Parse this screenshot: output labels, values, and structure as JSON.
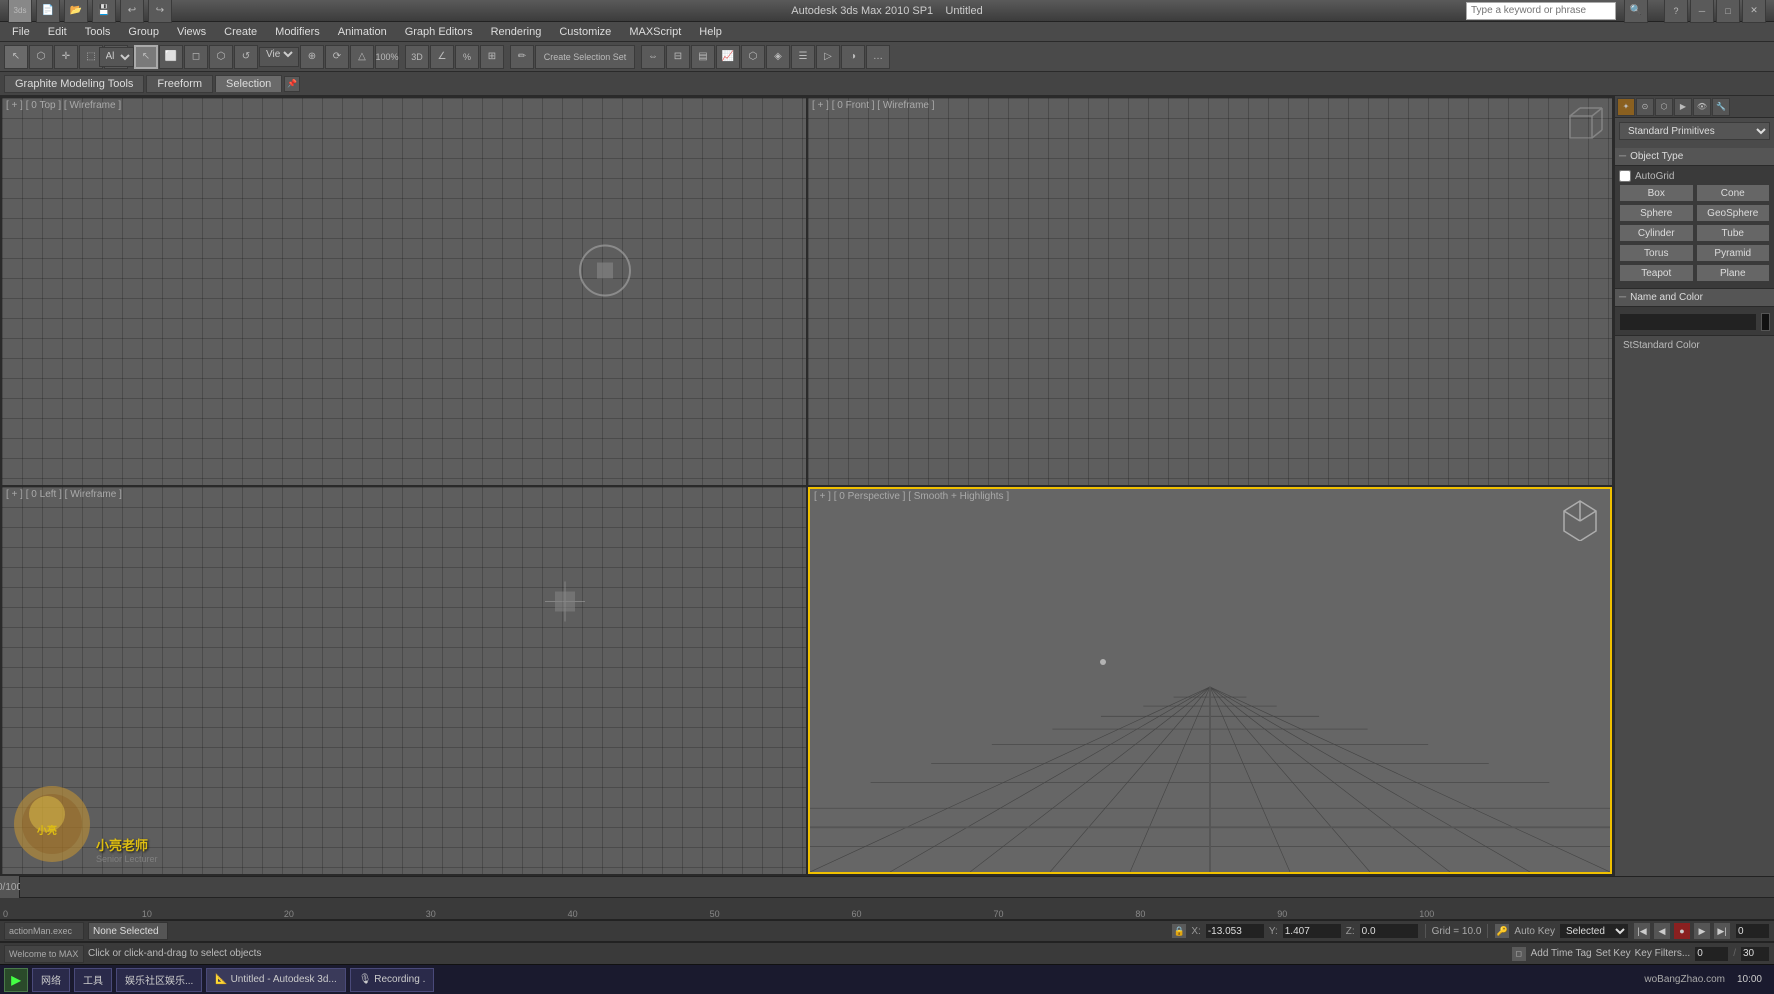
{
  "titlebar": {
    "app_name": "Autodesk 3ds Max  2010 SP1",
    "file_name": "Untitled",
    "search_placeholder": "Type a keyword or phrase"
  },
  "menubar": {
    "items": [
      "File",
      "Edit",
      "Tools",
      "Group",
      "Views",
      "Create",
      "Modifiers",
      "Animation",
      "Graph Editors",
      "Rendering",
      "Customize",
      "MAXScript",
      "Help"
    ]
  },
  "toolbar2": {
    "tabs": [
      "Graphite Modeling Tools",
      "Freeform",
      "Selection"
    ],
    "active_tab": "Selection"
  },
  "rightpanel": {
    "dropdown_value": "Standard Primitives",
    "section_object_type": "Object Type",
    "autogrid_label": "AutoGrid",
    "buttons": [
      "Box",
      "Cone",
      "Sphere",
      "GeoSphere",
      "Cylinder",
      "Tube",
      "Torus",
      "Pyramid",
      "Teapot",
      "Plane"
    ],
    "section_name_color": "Name and Color",
    "name_value": "",
    "standard_color_label": "Standard Color"
  },
  "viewports": {
    "top": {
      "label": "[ + ] [ 0 Top ] [ Wireframe ]"
    },
    "front": {
      "label": "[ + ] [ 0 Front ] [ Wireframe ]"
    },
    "left": {
      "label": "[ + ] [ 0 Left ] [ Wireframe ]"
    },
    "perspective": {
      "label": "[ + ] [ 0 Perspective ] [ Smooth + Highlights ]",
      "active": true
    }
  },
  "statusbar": {
    "selection_text": "None Selected",
    "hint_text": "Click or click-and-drag to select objects",
    "x_label": "X:",
    "y_label": "Y:",
    "z_label": "Z:",
    "x_value": "-13.053",
    "y_value": "1.407",
    "z_value": "0.0",
    "grid_label": "Grid = 10.0",
    "auto_key_label": "Auto Key",
    "selected_label": "Selected",
    "set_key_label": "Set Key",
    "key_filters_label": "Key Filters..."
  },
  "timeline": {
    "start": "0",
    "end": "100",
    "ticks": [
      "0",
      "10",
      "20",
      "30",
      "40",
      "50",
      "60",
      "70",
      "80",
      "90",
      "100"
    ]
  },
  "taskbar": {
    "items": [
      "网络",
      "工具",
      "娱乐社区娱乐...",
      "Untitled - Autodesk 3d...",
      "Recording..."
    ],
    "right_text": "woBangZhao.com"
  },
  "icons": {
    "search": "🔍",
    "minimize": "─",
    "maximize": "□",
    "close": "✕",
    "play": "▶",
    "stop": "■",
    "prev": "◀◀",
    "next": "▶▶",
    "record": "●",
    "key": "🔑"
  }
}
